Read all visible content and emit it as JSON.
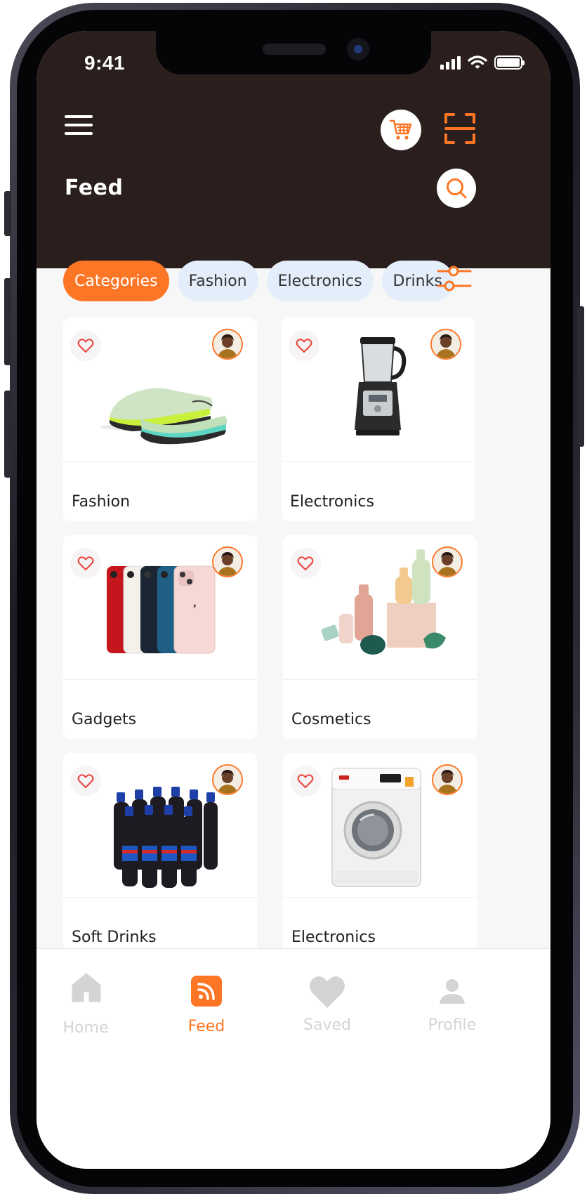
{
  "status_bar": {
    "time": "9:41"
  },
  "header": {
    "title": "Feed"
  },
  "chips": [
    {
      "label": "Categories",
      "active": true
    },
    {
      "label": "Fashion",
      "active": false
    },
    {
      "label": "Electronics",
      "active": false
    },
    {
      "label": "Drinks",
      "active": false
    }
  ],
  "cards": [
    {
      "label": "Fashion",
      "image": "sneakers"
    },
    {
      "label": "Electronics",
      "image": "blender"
    },
    {
      "label": "Gadgets",
      "image": "smartphones"
    },
    {
      "label": "Cosmetics",
      "image": "cosmetic-bottles"
    },
    {
      "label": "Soft Drinks",
      "image": "soda-bottle-pack"
    },
    {
      "label": "Electronics",
      "image": "washing-machine"
    }
  ],
  "nav": [
    {
      "label": "Home",
      "icon": "home-icon",
      "active": false
    },
    {
      "label": "Feed",
      "icon": "rss-icon",
      "active": true
    },
    {
      "label": "Saved",
      "icon": "heart-icon",
      "active": false
    },
    {
      "label": "Profile",
      "icon": "user-icon",
      "active": false
    }
  ],
  "colors": {
    "accent": "#fd7626",
    "header_bg": "#2a1f1d",
    "chip_bg": "#e4eefb",
    "page_bg": "#f7f7f7",
    "inactive_nav": "#d4d4d4"
  }
}
